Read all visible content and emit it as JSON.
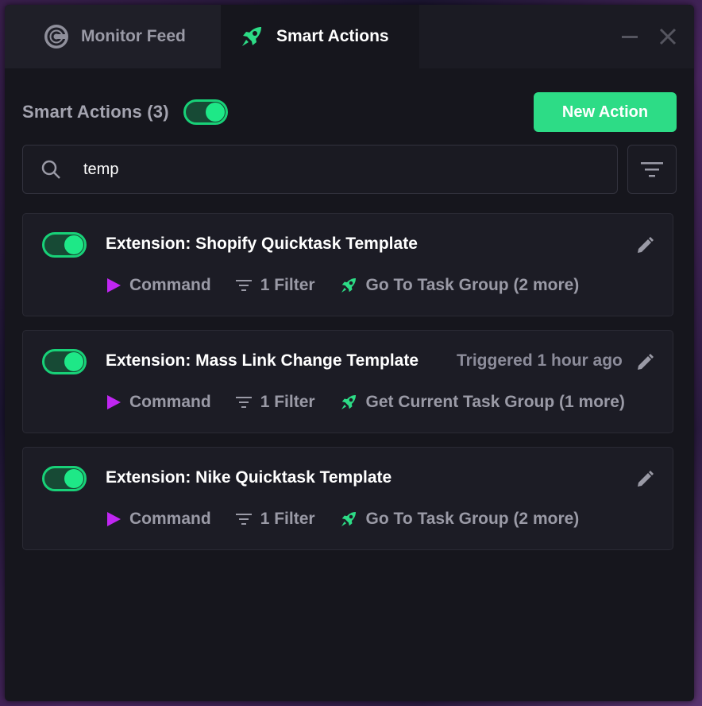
{
  "tabs": [
    {
      "label": "Monitor Feed",
      "icon": "monitor-feed-icon",
      "active": false
    },
    {
      "label": "Smart Actions",
      "icon": "rocket-icon",
      "active": true
    }
  ],
  "header": {
    "title": "Smart Actions (3)",
    "enabled": true,
    "new_action_label": "New Action"
  },
  "search": {
    "value": "temp",
    "placeholder": ""
  },
  "colors": {
    "accent_green": "#2ddc86",
    "command_purple": "#c026f2",
    "background": "#16161d"
  },
  "actions": [
    {
      "title": "Extension: Shopify Quicktask Template",
      "triggered": "",
      "enabled": true,
      "trigger": "Command",
      "filters": "1 Filter",
      "result": "Go To Task Group (2 more)"
    },
    {
      "title": "Extension: Mass Link Change Template",
      "triggered": "Triggered 1 hour ago",
      "enabled": true,
      "trigger": "Command",
      "filters": "1 Filter",
      "result": "Get Current Task Group (1 more)"
    },
    {
      "title": "Extension: Nike Quicktask Template",
      "triggered": "",
      "enabled": true,
      "trigger": "Command",
      "filters": "1 Filter",
      "result": "Go To Task Group (2 more)"
    }
  ]
}
